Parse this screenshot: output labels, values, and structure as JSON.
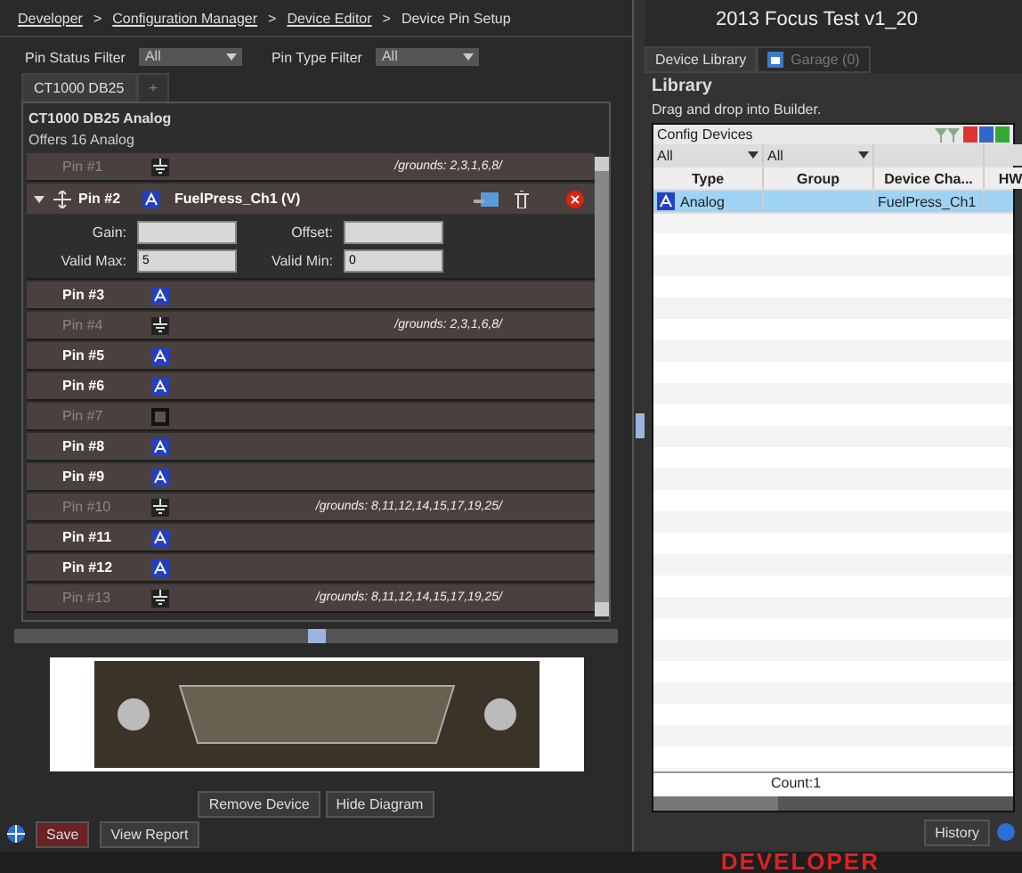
{
  "breadcrumb": [
    {
      "label": "Developer",
      "link": true
    },
    {
      "separator": ">",
      "label": "Configuration Manager",
      "link": true
    },
    {
      "separator": ">",
      "label": "Device Editor",
      "link": true
    },
    {
      "separator": ">",
      "label": "Device Pin Setup",
      "link": false
    }
  ],
  "title": "2013 Focus Test v1_20",
  "filters": [
    {
      "label": "Pin Status Filter",
      "value": "All"
    },
    {
      "label": "Pin Type Filter",
      "value": "All"
    }
  ],
  "device_tabs": [
    {
      "label": "CT1000 DB25",
      "selected": true
    },
    {
      "label": "+",
      "selected": false
    }
  ],
  "device": {
    "name": "CT1000 DB25 Analog",
    "offers": "Offers 16 Analog"
  },
  "pins": [
    {
      "label": "Pin #1",
      "kind": "ground",
      "note": "/grounds: 2,3,1,6,8/",
      "expanded": false
    },
    {
      "label": "Pin #2",
      "kind": "analog",
      "name": "FuelPress_Ch1 (V)",
      "expanded": true,
      "fields": [
        {
          "label": "Gain:"
        },
        {
          "label": "Offset:"
        },
        {
          "label": "Valid Max:",
          "value": "5"
        },
        {
          "label": "Valid Min:",
          "value": "0"
        }
      ]
    },
    {
      "label": "Pin #3",
      "kind": "analog",
      "expanded": false
    },
    {
      "label": "Pin #4",
      "kind": "ground",
      "note": "/grounds: 2,3,1,6,8/",
      "expanded": false
    },
    {
      "label": "Pin #5",
      "kind": "analog",
      "expanded": false
    },
    {
      "label": "Pin #6",
      "kind": "analog",
      "expanded": false
    },
    {
      "label": "Pin #7",
      "kind": "unused",
      "expanded": false
    },
    {
      "label": "Pin #8",
      "kind": "analog",
      "expanded": false
    },
    {
      "label": "Pin #9",
      "kind": "analog",
      "expanded": false
    },
    {
      "label": "Pin #10",
      "kind": "ground",
      "note": "/grounds: 8,11,12,14,15,17,19,25/",
      "expanded": false
    },
    {
      "label": "Pin #11",
      "kind": "analog",
      "expanded": false
    },
    {
      "label": "Pin #12",
      "kind": "analog",
      "expanded": false
    },
    {
      "label": "Pin #13",
      "kind": "ground",
      "note": "/grounds: 8,11,12,14,15,17,19,25/",
      "expanded": false
    }
  ],
  "diagram_buttons": [
    "Remove Device",
    "Hide Diagram"
  ],
  "bottom_buttons": [
    {
      "label": "Save",
      "kind": "primary"
    },
    {
      "label": "View Report",
      "kind": "plain"
    }
  ],
  "history": "History",
  "library": {
    "tabs": [
      {
        "label": "Device Library",
        "selected": true,
        "disabled": false
      },
      {
        "label": "Garage (0)",
        "selected": false,
        "disabled": true
      }
    ],
    "heading": "Library",
    "hint": "Drag and drop into Builder.",
    "grid": {
      "title": "Config Devices",
      "filters": [
        "All",
        "All"
      ],
      "columns": [
        "Type",
        "Group",
        "Device Cha...",
        "HW"
      ],
      "rows": [
        {
          "type": "Analog",
          "device": "FuelPress_Ch1",
          "selected": true
        }
      ],
      "count": "Count:1"
    }
  },
  "status_bar": {
    "brand": "DEVELOPER"
  }
}
